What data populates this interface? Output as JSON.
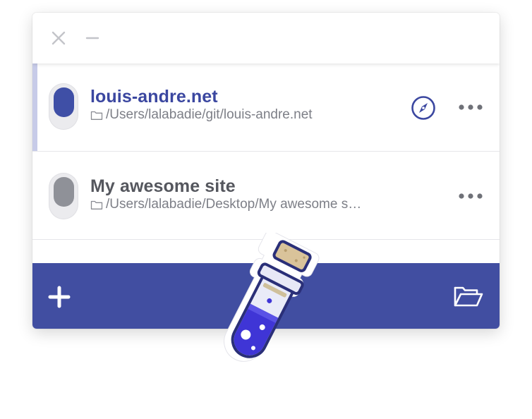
{
  "window": {
    "controls": {
      "close_icon": "close-icon",
      "minimize_icon": "minimize-icon"
    }
  },
  "sites": [
    {
      "name": "louis-andre.net",
      "path": "/Users/lalabadie/git/louis-andre.net",
      "running": true,
      "active": true,
      "actions": [
        "compass-icon",
        "more-icon"
      ]
    },
    {
      "name": "My awesome site",
      "path": "/Users/lalabadie/Desktop/My awesome s…",
      "running": false,
      "active": false,
      "actions": [
        "more-icon"
      ]
    }
  ],
  "footer": {
    "add_icon": "plus-icon",
    "open_icon": "open-folder-icon"
  },
  "colors": {
    "accent": "#414ea1",
    "accent_text": "#3b47a0",
    "toggle_on": "#3f4fa6",
    "toggle_off": "#8f9198",
    "active_bar": "#c7cbe8"
  },
  "logo": {
    "icon": "potion-flask-logo"
  }
}
